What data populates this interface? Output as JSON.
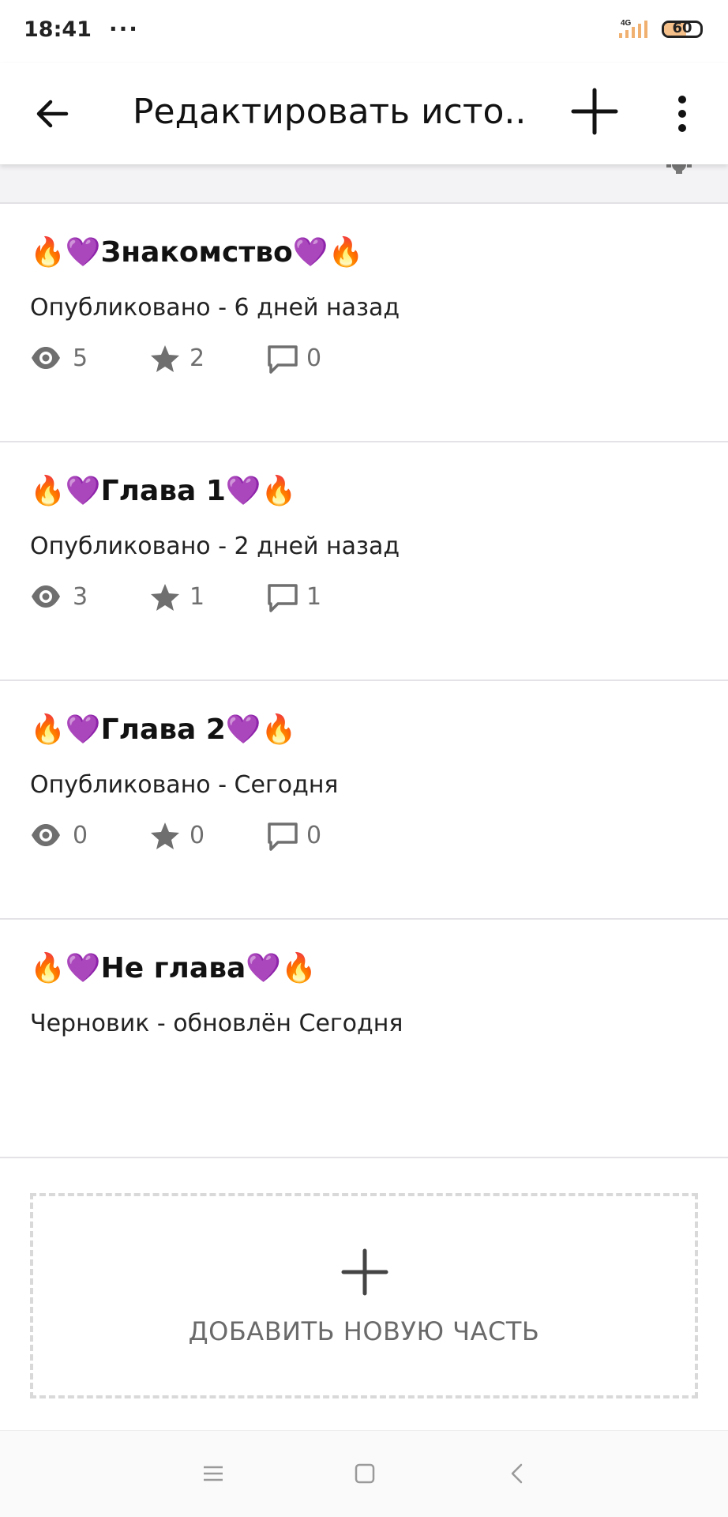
{
  "status_bar": {
    "time": "18:41",
    "dots": "···",
    "network": "4G",
    "battery": "60",
    "battery_level": 0.6
  },
  "app_bar": {
    "title": "Редактировать исто...",
    "back_icon": "arrow-left-icon",
    "add_icon": "plus-icon",
    "more_icon": "more-vertical-icon"
  },
  "parts": [
    {
      "title": "🔥💜Знакомство💜🔥",
      "status": "Опубликовано - 6 дней назад",
      "views": "5",
      "votes": "2",
      "comments": "0"
    },
    {
      "title": "🔥💜Глава 1💜🔥",
      "status": "Опубликовано - 2 дней назад",
      "views": "3",
      "votes": "1",
      "comments": "1"
    },
    {
      "title": "🔥💜Глава 2💜🔥",
      "status": "Опубликовано - Сегодня",
      "views": "0",
      "votes": "0",
      "comments": "0"
    },
    {
      "title": "🔥💜Не глава💜🔥",
      "status": "Черновик - обновлён Сегодня"
    }
  ],
  "add_part": {
    "label": "ДОБАВИТЬ НОВУЮ ЧАСТЬ",
    "icon": "plus-icon"
  },
  "nav_bar": {
    "menu_icon": "menu-icon",
    "home_icon": "square-icon",
    "back_icon": "chevron-left-icon"
  },
  "colors": {
    "icon_gray": "#6f6f6f",
    "divider": "#e4e2e6",
    "dashed_border": "#d9d9d9"
  }
}
